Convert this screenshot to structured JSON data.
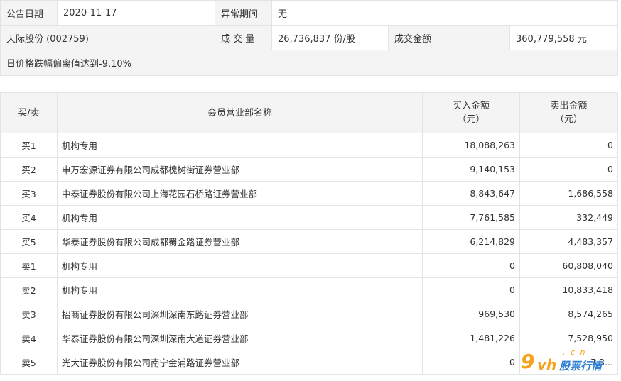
{
  "info": {
    "date_label": "公告日期",
    "date_value": "2020-11-17",
    "abnormal_label": "异常期间",
    "abnormal_value": "无",
    "stock_name": "天际股份 (002759)",
    "volume_label": "成 交 量",
    "volume_value": "26,736,837 份/股",
    "amount_label": "成交金额",
    "amount_value": "360,779,558 元",
    "reason": "日价格跌幅偏离值达到-9.10%"
  },
  "table": {
    "headers": {
      "side": "买/卖",
      "member": "会员营业部名称",
      "buy_line1": "买入金额",
      "buy_line2": "（元）",
      "sell_line1": "卖出金额",
      "sell_line2": "（元）"
    },
    "rows": [
      {
        "side": "买1",
        "name": "机构专用",
        "buy": "18,088,263",
        "sell": "0"
      },
      {
        "side": "买2",
        "name": "申万宏源证券有限公司成都槐树街证券营业部",
        "buy": "9,140,153",
        "sell": "0"
      },
      {
        "side": "买3",
        "name": "中泰证券股份有限公司上海花园石桥路证券营业部",
        "buy": "8,843,647",
        "sell": "1,686,558"
      },
      {
        "side": "买4",
        "name": "机构专用",
        "buy": "7,761,585",
        "sell": "332,449"
      },
      {
        "side": "买5",
        "name": "华泰证券股份有限公司成都蜀金路证券营业部",
        "buy": "6,214,829",
        "sell": "4,483,357"
      },
      {
        "side": "卖1",
        "name": "机构专用",
        "buy": "0",
        "sell": "60,808,040"
      },
      {
        "side": "卖2",
        "name": "机构专用",
        "buy": "0",
        "sell": "10,833,418"
      },
      {
        "side": "卖3",
        "name": "招商证券股份有限公司深圳深南东路证券营业部",
        "buy": "969,530",
        "sell": "8,574,265"
      },
      {
        "side": "卖4",
        "name": "华泰证券股份有限公司深圳深南大道证券营业部",
        "buy": "1,481,226",
        "sell": "7,528,950"
      },
      {
        "side": "卖5",
        "name": "光大证券股份有限公司南宁金浦路证券营业部",
        "buy": "0",
        "sell": "7,3..."
      }
    ]
  },
  "watermark": {
    "nine": "9",
    "vh": "vh",
    "cn": ". c n",
    "text": "股票行情"
  }
}
